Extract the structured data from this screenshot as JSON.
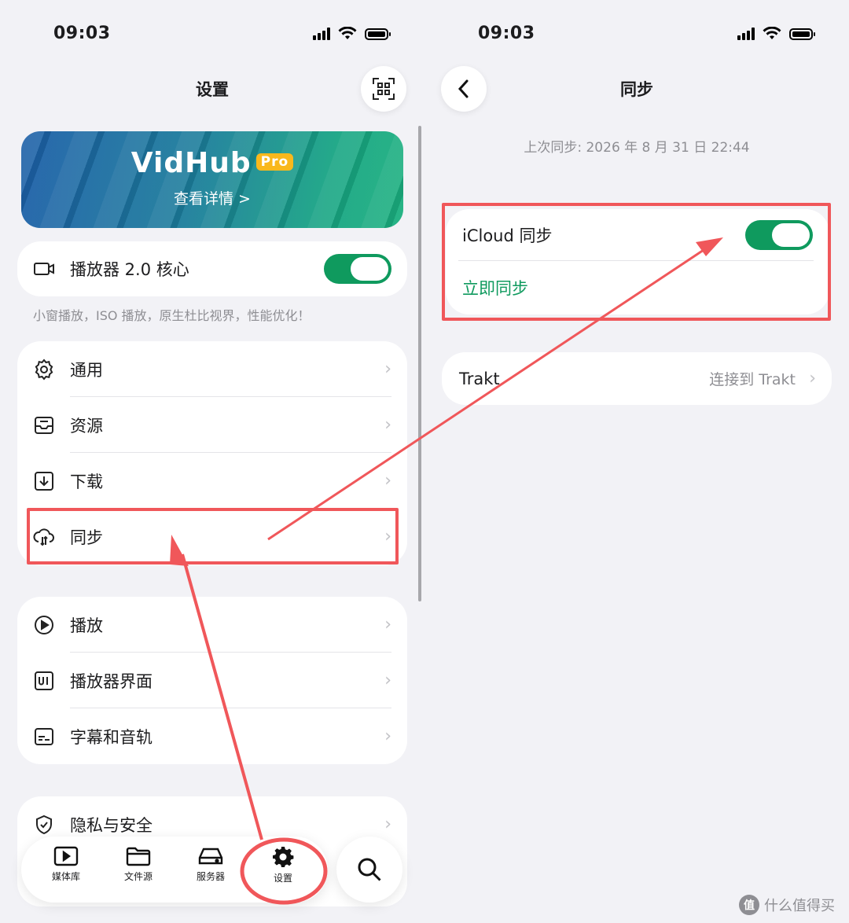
{
  "left": {
    "status_time": "09:03",
    "title": "设置",
    "banner": {
      "brand": "VidHub",
      "badge": "Pro",
      "cta": "查看详情 >"
    },
    "player_core": {
      "label": "播放器 2.0 核心",
      "enabled": true,
      "caption": "小窗播放，ISO 播放，原生杜比视界，性能优化！"
    },
    "group1": [
      {
        "label": "通用",
        "icon": "gear-icon"
      },
      {
        "label": "资源",
        "icon": "inbox-icon"
      },
      {
        "label": "下载",
        "icon": "download-icon"
      },
      {
        "label": "同步",
        "icon": "cloud-sync-icon"
      }
    ],
    "group2": [
      {
        "label": "播放",
        "icon": "play-circle-icon"
      },
      {
        "label": "播放器界面",
        "icon": "ui-icon"
      },
      {
        "label": "字幕和音轨",
        "icon": "subtitle-icon"
      }
    ],
    "group3": [
      {
        "label": "隐私与安全",
        "icon": "shield-icon"
      }
    ],
    "tabbar": [
      {
        "label": "媒体库",
        "icon": "play-box-icon"
      },
      {
        "label": "文件源",
        "icon": "folder-icon"
      },
      {
        "label": "服务器",
        "icon": "server-icon"
      },
      {
        "label": "设置",
        "icon": "gear-icon"
      }
    ]
  },
  "right": {
    "status_time": "09:03",
    "title": "同步",
    "last_sync": "上次同步: 2026 年 8 月 31 日 22:44",
    "icloud": {
      "label": "iCloud 同步",
      "enabled": true,
      "action": "立即同步"
    },
    "trakt": {
      "label": "Trakt",
      "value": "连接到 Trakt"
    }
  },
  "watermark": "什么值得买",
  "colors": {
    "accent_green": "#0f9a5e",
    "annotation_red": "#f0575a",
    "background": "#f2f2f6"
  }
}
